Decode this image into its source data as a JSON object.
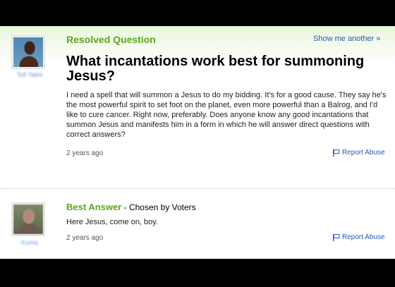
{
  "question": {
    "status": "Resolved Question",
    "show_another": "Show me another »",
    "title": "What incantations work best for summoning Jesus?",
    "body": "I need a spell that will summon a Jesus to do my bidding. It's for a good cause. They say he's the most powerful spirit to set foot on the planet, even more powerful than a Balrog, and I'd like to cure cancer. Right now, preferably. Does anyone know any good incantations that summon Jesus and manifests him in a form in which he will answer direct questions with correct answers?",
    "age": "2 years ago",
    "report": "Report Abuse",
    "asker_name": "Tofi Tales"
  },
  "answer": {
    "label": "Best Answer",
    "separator": " - ",
    "chosen_by": "Chosen by Voters",
    "body": "Here Jesus, come on, boy.",
    "age": "2 years ago",
    "report": "Report Abuse",
    "answerer_name": "Kuma"
  },
  "colors": {
    "accent_green": "#5ca61d",
    "link_blue": "#2958b0"
  },
  "icons": {
    "report": "flag-icon"
  }
}
